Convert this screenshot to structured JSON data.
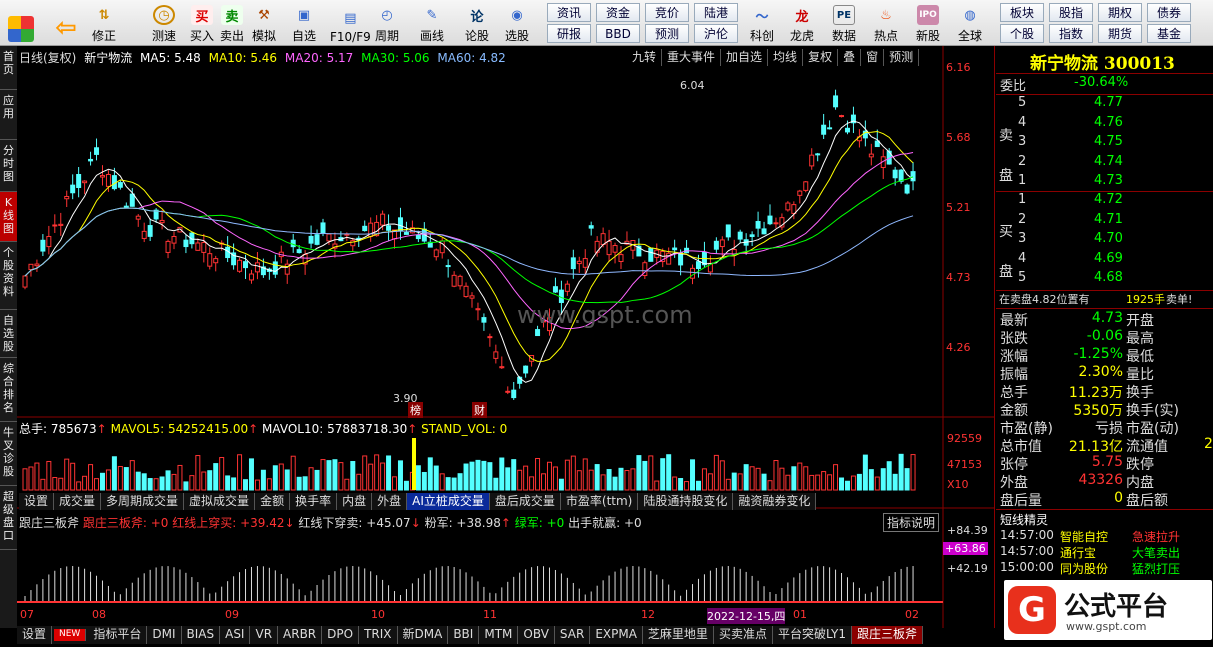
{
  "toolbar": {
    "items": [
      "",
      "",
      "修正",
      "测速",
      "买入",
      "卖出",
      "模拟",
      "自选",
      "F10/F9",
      "周期",
      "画线",
      "论股",
      "选股"
    ],
    "small": [
      [
        "资讯",
        "资金",
        "竞价",
        "陆港"
      ],
      [
        "研报",
        "BBD",
        "预测",
        "沪伦"
      ]
    ],
    "icons2": [
      "科创",
      "龙虎",
      "数据",
      "热点",
      "新股",
      "全球"
    ],
    "right": [
      [
        "板块",
        "股指",
        "期权",
        "债券"
      ],
      [
        "个股",
        "指数",
        "期货",
        "基金"
      ]
    ]
  },
  "chart": {
    "title": "日线(复权)",
    "name": "新宁物流",
    "ma5": "MA5: 5.48",
    "ma10": "MA10: 5.46",
    "ma20": "MA20: 5.17",
    "ma30": "MA30: 5.06",
    "ma60": "MA60: 4.82",
    "buttons": [
      "九转",
      "重大事件",
      "加自选",
      "均线",
      "复权",
      "叠",
      "窗",
      "预测"
    ],
    "prices": [
      "6.16",
      "5.68",
      "5.21",
      "4.73",
      "4.26"
    ],
    "high": "6.04",
    "low": "3.90",
    "badge1": "榜",
    "badge2": "财",
    "watermark": "www.gspt.com"
  },
  "vol": {
    "total": "总手: 785673",
    "mavol5": "MAVOL5: 54252415.00",
    "mavol10": "MAVOL10: 57883718.30",
    "stand": "STAND_VOL: 0",
    "t1": "92559",
    "t2": "47153",
    "t3": "X10",
    "tabs": [
      "设置",
      "成交量",
      "多周期成交量",
      "虚拟成交量",
      "金额",
      "换手率",
      "内盘",
      "外盘",
      "AI立桩成交量",
      "盘后成交量",
      "市盈率(ttm)",
      "陆股通持股变化",
      "融资融券变化"
    ]
  },
  "ind": {
    "name": "跟庄三板斧",
    "a": "跟庄三板斧: +0",
    "b": "红线上穿买: +39.42",
    "c": "红线下穿卖: +45.07",
    "d": "粉军: +38.98",
    "e": "绿军: +0",
    "f": "出手就赢: +0",
    "help": "指标说明",
    "v1": "+84.39",
    "v2": "+63.86",
    "v3": "+42.19"
  },
  "dates": [
    "07",
    "08",
    "09",
    "10",
    "11",
    "12",
    "2022-12-15,四",
    "01",
    "02"
  ],
  "bottomTabs": [
    "设置",
    "NEW",
    "指标平台",
    "DMI",
    "BIAS",
    "ASI",
    "VR",
    "ARBR",
    "DPO",
    "TRIX",
    "新DMA",
    "BBI",
    "MTM",
    "OBV",
    "SAR",
    "EXPMA",
    "芝麻里地里",
    "买卖准点",
    "平台突破LY1",
    "跟庄三板斧"
  ],
  "left": [
    "首页",
    "应用",
    "分时图",
    "K线图",
    "个股资料",
    "自选股",
    "综合排名",
    "牛叉诊股",
    "超级盘口"
  ],
  "quote": {
    "title": "新宁物流 300013",
    "webi": "委比",
    "webiv": "-30.64%",
    "sell": [
      [
        "5",
        "4.77"
      ],
      [
        "4",
        "4.76"
      ],
      [
        "3",
        "4.75"
      ],
      [
        "2",
        "4.74"
      ],
      [
        "1",
        "4.73"
      ]
    ],
    "buy": [
      [
        "1",
        "4.72"
      ],
      [
        "2",
        "4.71"
      ],
      [
        "3",
        "4.70"
      ],
      [
        "4",
        "4.69"
      ],
      [
        "5",
        "4.68"
      ]
    ],
    "sellLbl": "卖盘",
    "buyLbl": "买盘",
    "note": "在卖盘4.82位置有",
    "noteV": "1925手",
    "noteE": "卖单!",
    "stats": [
      [
        "最新",
        "4.73",
        "开盘",
        ""
      ],
      [
        "张跌",
        "-0.06",
        "最高",
        ""
      ],
      [
        "涨幅",
        "-1.25%",
        "最低",
        ""
      ],
      [
        "振幅",
        "2.30%",
        "量比",
        ""
      ],
      [
        "总手",
        "11.23万",
        "换手",
        ""
      ],
      [
        "金额",
        "5350万",
        "换手(实)",
        ""
      ],
      [
        "市盈(静)",
        "亏损",
        "市盈(动)",
        ""
      ],
      [
        "总市值",
        "21.13亿",
        "流通值",
        "2"
      ],
      [
        "张停",
        "5.75",
        "跌停",
        ""
      ],
      [
        "外盘",
        "43326",
        "内盘",
        ""
      ],
      [
        "盘后量",
        "0",
        "盘后额",
        ""
      ]
    ],
    "sprite": "短线精灵",
    "events": [
      [
        "14:57:00",
        "智能自控",
        "急速拉升"
      ],
      [
        "14:57:00",
        "通行宝",
        "大笔卖出"
      ],
      [
        "15:00:00",
        "同为股份",
        "猛烈打压"
      ]
    ],
    "logo": "公式平台",
    "logoUrl": "www.gspt.com"
  },
  "colors": {
    "up": "#ff3333",
    "down": "#54ffff",
    "ma5": "#ffffff",
    "ma10": "#ffff00",
    "ma20": "#ff66ff",
    "ma30": "#00ff00",
    "ma60": "#8fb8ff"
  }
}
